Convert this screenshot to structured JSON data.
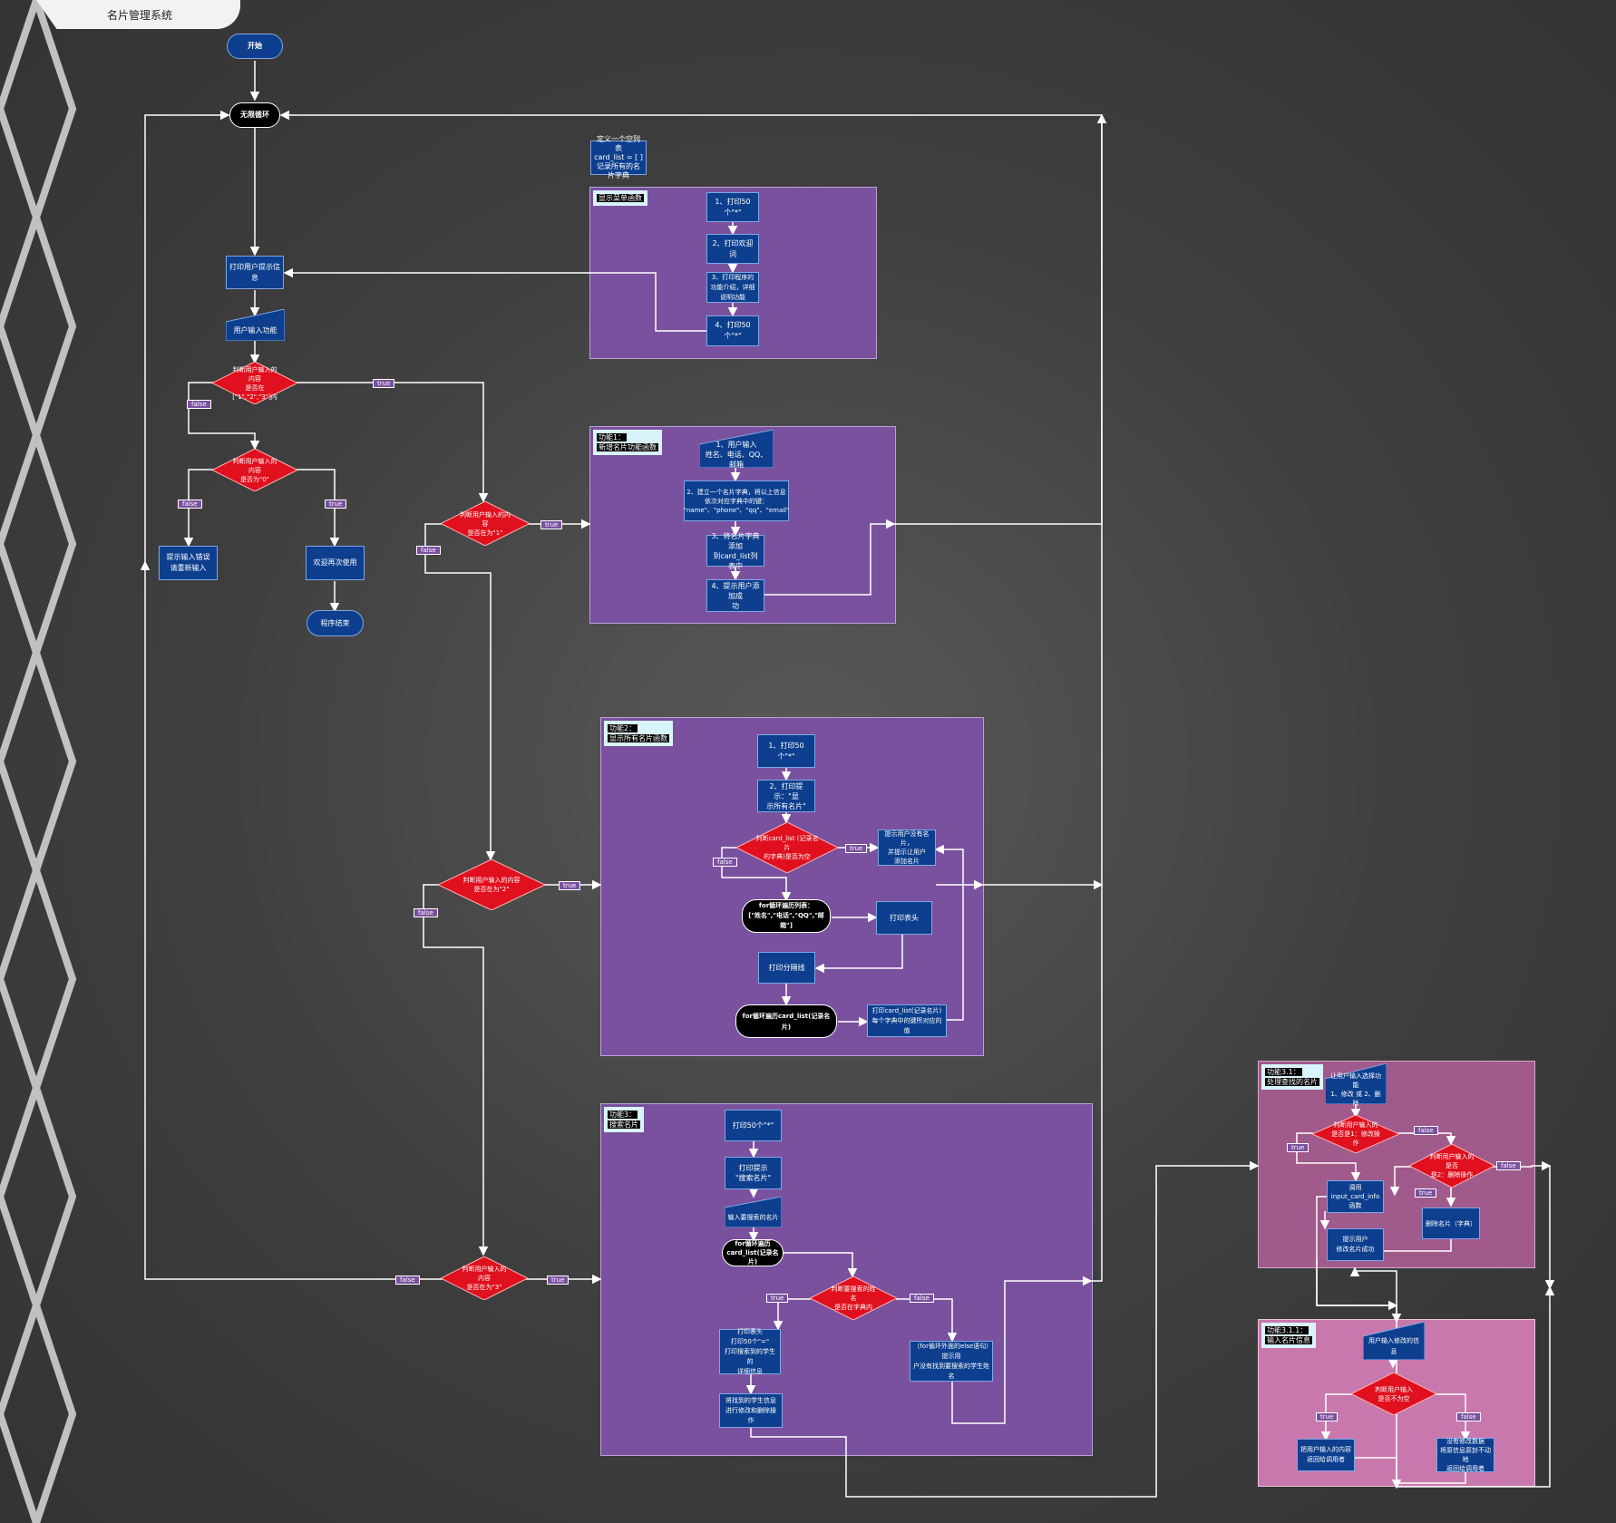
{
  "title": "名片管理系统",
  "colors": {
    "process": "#0d3f8e",
    "decision": "#e0101e",
    "panel": "#7a519e",
    "panel_pink": "#a05a8b",
    "panel_light_pink": "#c978ad",
    "wire": "#ffffff"
  },
  "nodes": {
    "start": "开始",
    "loop": "无限循环",
    "define_list": "定义一个空列表\ncard_list = [ ]\n记录所有的名片字典",
    "print_prompt": "打印用户提示信息",
    "user_input": "用户输入功能",
    "dec_in_range": "判断用户输入的内容\n是否在[\"1\",\"2\",\"3\"]内",
    "dec_is0": "判断用户输入的内容\n是否为\"0\"",
    "input_error": "提示输入错误\n请重新输入",
    "welcome": "欢迎再次使用",
    "program_end": "程序结束",
    "dec_is1": "判断用户输入的内容\n是否在为\"1\"",
    "dec_is2": "判断用户输入的内容\n是否在为\"2\"",
    "dec_is3": "判断用户输入的内容\n是否在为\"3\""
  },
  "menu_panel": {
    "label": "显示菜单函数",
    "steps": [
      "1、打印50个\"*\"",
      "2、打印欢迎词",
      "3、打印程序的功能介绍，详细说明功能",
      "4、打印50个\"*\""
    ]
  },
  "f1_panel": {
    "label_line1": "功能1：",
    "label_line2": "新增名片功能函数",
    "input": "1、用户输入\n姓名、电话、QQ、邮箱",
    "step2": "2、建立一个名片字典，将以上信息\n依次对应字典中的键：\n\"name\"、\"phone\"、\"qq\"、\"email\"",
    "step3": "3、将名片字典添加\n到card_list列表中",
    "step4": "4、提示用户添加成\n功"
  },
  "f2_panel": {
    "label_line1": "功能2：",
    "label_line2": "显示所有名片函数",
    "step1": "1、打印50个\"*\"",
    "step2": "2、打印提示：\"显\n示所有名片\"",
    "decision": "判断card_list (记录名片\n的字典)是否为空",
    "no_cards": "提示用户没有名片，\n并提示让用户\n添加名片",
    "for_header": "for循环遍历列表：\n[\"姓名\",\"电话\",\"QQ\",\"邮箱\"]",
    "print_header": "打印表头",
    "print_divider": "打印分隔线",
    "for_cards": "for循环遍历card_list(记录名片)",
    "print_cards": "打印card_list(记录名片)\n每个字典中的键所对应的值"
  },
  "f3_panel": {
    "label_line1": "功能3：",
    "label_line2": "搜索名片",
    "step1": "打印50个\"*\"",
    "step2": "打印提示\n\"搜索名片\"",
    "input": "输入要搜索的名片",
    "for_loop": "for循环遍历\ncard_list(记录名片)",
    "decision": "判断要搜索的姓名\n是否在字典内",
    "found": "打印表头\n打印50个\"=\"\n打印搜索到的学生的\n详细信息",
    "not_found": "（for循环外面的else语句）提示用\n户没有找到要搜索的学生姓名",
    "process_found": "将找到的学生信息\n进行修改和删除操作"
  },
  "f31_panel": {
    "label_line1": "功能3.1：",
    "label_line2": "处理查找的名片",
    "input": "让用户输入选择功能\n1、修改 或 2、删除",
    "dec1": "判断用户输入的\n是否是1：修改操作",
    "dec2": "判断用户输入的是否\n是2：删除操作",
    "call": "调用\ninput_card_info\n函数",
    "delete": "删除名片（字典）",
    "success": "提示用户\n修改名片成功"
  },
  "f311_panel": {
    "label_line1": "功能3.1.1：",
    "label_line2": "输入名片信息",
    "input": "用户输入修改的信息",
    "decision": "判断用户输入\n是否不为空",
    "true_node": "把用户输入的内容\n返回给调用者",
    "false_node": "没有修改数据\n将原信息原封不动地\n返回给调用者"
  },
  "tags": {
    "true": "true",
    "false": "false"
  }
}
